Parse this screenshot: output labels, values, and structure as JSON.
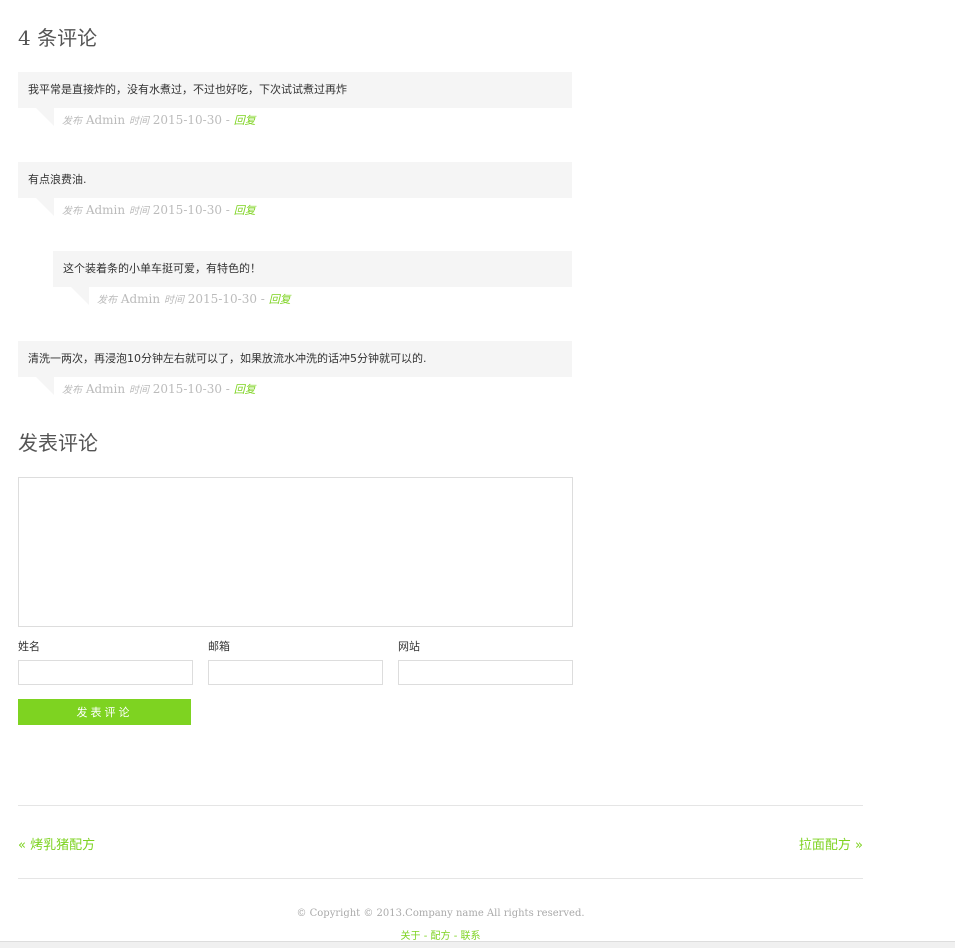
{
  "comments_section": {
    "title": "4 条评论",
    "posted_label": "发布",
    "time_label": "时间",
    "reply_label": "回复",
    "separator": "-",
    "items": [
      {
        "text": "我平常是直接炸的，没有水煮过，不过也好吃，下次试试煮过再炸",
        "author": "Admin",
        "date": "2015-10-30"
      },
      {
        "text": "有点浪费油.",
        "author": "Admin",
        "date": "2015-10-30"
      },
      {
        "text": "这个装着条的小单车挺可爱，有特色的！",
        "author": "Admin",
        "date": "2015-10-30"
      },
      {
        "text": "清洗一两次，再浸泡10分钟左右就可以了，如果放流水冲洗的话冲5分钟就可以的.",
        "author": "Admin",
        "date": "2015-10-30"
      }
    ]
  },
  "comment_form": {
    "title": "发表评论",
    "textarea_value": "",
    "name_label": "姓名",
    "name_value": "",
    "email_label": "邮箱",
    "email_value": "",
    "website_label": "网站",
    "website_value": "",
    "submit_label": "发表评论"
  },
  "post_nav": {
    "prev": "« 烤乳猪配方",
    "next": "拉面配方 »"
  },
  "footer": {
    "copyright": "© Copyright © 2013.Company name All rights reserved.",
    "link_about": "关于",
    "link_recipes": "配方",
    "link_contact": "联系",
    "link_sep": "-"
  },
  "colors": {
    "accent": "#7ed321",
    "bubble_bg": "#f5f5f5",
    "meta_text": "#bbbbbb"
  }
}
